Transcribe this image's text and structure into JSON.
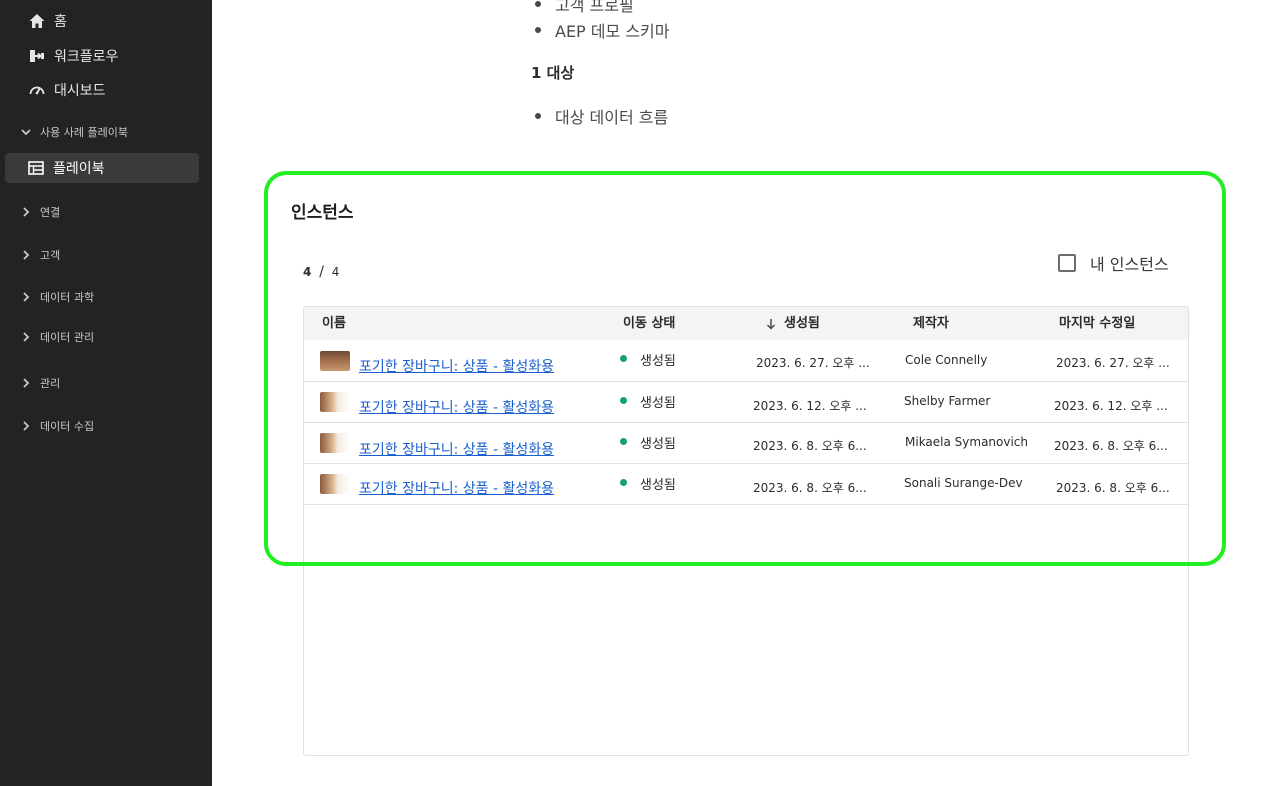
{
  "sidebar": {
    "home_label": "홈",
    "workflows_label": "워크플로우",
    "dashboards_label": "대시보드",
    "playbooks_section": "사용 사례 플레이북",
    "playbooks_label": "플레이북",
    "sections": [
      "연결",
      "고객",
      "데이터 과학",
      "데이터 관리",
      "관리",
      "데이터 수집"
    ]
  },
  "doc": {
    "bullets_top": [
      "고객 프로필",
      "AEP 데모 스키마"
    ],
    "heading": "1 대상",
    "bullets_bottom": [
      "대상 데이터 흐름"
    ]
  },
  "instances": {
    "title": "인스턴스",
    "count_current": "4",
    "count_sep": "/",
    "count_total": "4",
    "my_instances_label": "내 인스턴스",
    "columns": {
      "name": "이름",
      "status": "이동 상태",
      "created": "생성됨",
      "creator": "제작자",
      "modified": "마지막 수정일"
    },
    "rows": [
      {
        "name": "포기한 장바구니: 상품 - 활성화용",
        "status": "생성됨",
        "created": "2023. 6. 27. 오후 ...",
        "creator": "Cole Connelly",
        "modified": "2023. 6. 27. 오후 ..."
      },
      {
        "name": "포기한 장바구니: 상품 - 활성화용",
        "status": "생성됨",
        "created": "2023. 6. 12. 오후 ...",
        "creator": "Shelby Farmer",
        "modified": "2023. 6. 12. 오후 ..."
      },
      {
        "name": "포기한 장바구니: 상품 - 활성화용",
        "status": "생성됨",
        "created": "2023. 6. 8. 오후 6...",
        "creator": "Mikaela Symanovich",
        "modified": "2023. 6. 8. 오후 6..."
      },
      {
        "name": "포기한 장바구니: 상품 - 활성화용",
        "status": "생성됨",
        "created": "2023. 6. 8. 오후 6...",
        "creator": "Sonali Surange-Dev",
        "modified": "2023. 6. 8. 오후 6..."
      }
    ]
  },
  "colors": {
    "sidebar_bg": "#232323",
    "highlight": "#22ee22",
    "link": "#1a5fd0",
    "status_ok": "#12a36c"
  }
}
